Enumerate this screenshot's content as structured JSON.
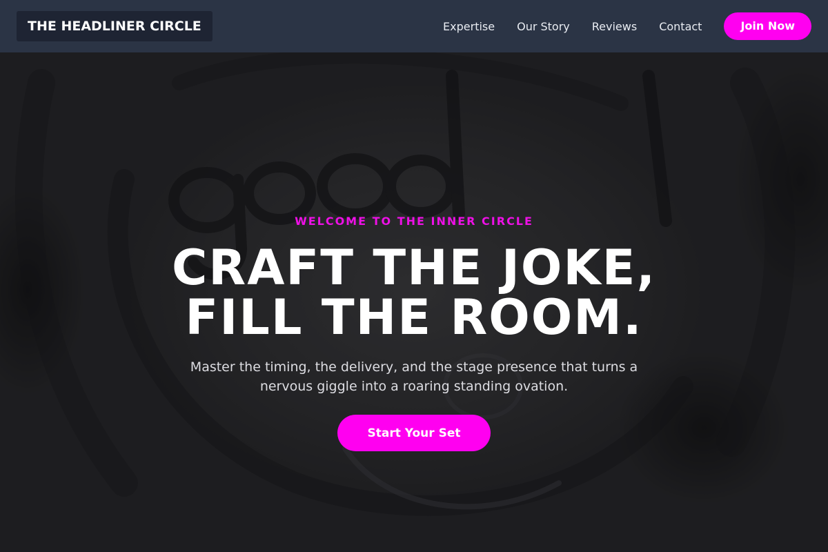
{
  "brand": {
    "name": "THE HEADLINER CIRCLE"
  },
  "nav": {
    "links": [
      "Expertise",
      "Our Story",
      "Reviews",
      "Contact"
    ],
    "join_label": "Join Now"
  },
  "hero": {
    "eyebrow": "WELCOME TO THE INNER CIRCLE",
    "headline_line1": "CRAFT THE JOKE,",
    "headline_line2": "FILL THE ROOM.",
    "subtext": "Master the timing, the delivery, and the stage presence that turns a nervous giggle into a roaring standing ovation.",
    "cta_label": "Start Your Set"
  },
  "colors": {
    "accent": "#ff00f0",
    "navbar": "#2b3445",
    "logo_bg": "#1e2433"
  }
}
